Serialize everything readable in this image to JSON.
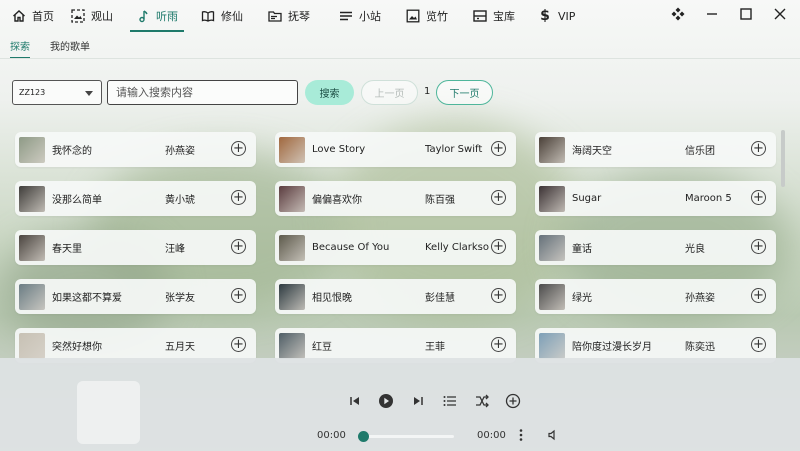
{
  "nav": {
    "items": [
      {
        "label": "首页",
        "icon": "home-icon"
      },
      {
        "label": "观山",
        "icon": "mountain-icon"
      },
      {
        "label": "听雨",
        "icon": "music-note-icon",
        "active": true
      },
      {
        "label": "修仙",
        "icon": "book-icon"
      },
      {
        "label": "抚琴",
        "icon": "folder-icon"
      },
      {
        "label": "小站",
        "icon": "menu-icon"
      },
      {
        "label": "览竹",
        "icon": "image-icon"
      },
      {
        "label": "宝库",
        "icon": "drive-icon"
      },
      {
        "label": "VIP",
        "icon": "dollar-icon"
      }
    ],
    "accent": "#1f7a6b"
  },
  "subtabs": [
    {
      "label": "探索",
      "active": true
    },
    {
      "label": "我的歌单",
      "active": false
    }
  ],
  "search": {
    "source_value": "ZZ123",
    "placeholder": "请输入搜索内容",
    "search_label": "搜索",
    "prev_label": "上一页",
    "page": "1",
    "next_label": "下一页"
  },
  "songs": [
    {
      "title": "我怀念的",
      "artist": "孙燕姿",
      "color": "#8e9a86"
    },
    {
      "title": "Love Story",
      "artist": "Taylor Swift",
      "color": "#a0683e"
    },
    {
      "title": "海阔天空",
      "artist": "信乐团",
      "color": "#4a4038"
    },
    {
      "title": "没那么简单",
      "artist": "黄小琥",
      "color": "#3f3d3a"
    },
    {
      "title": "偏偏喜欢你",
      "artist": "陈百强",
      "color": "#5b3c3f"
    },
    {
      "title": "Sugar",
      "artist": "Maroon 5",
      "color": "#3b3234"
    },
    {
      "title": "春天里",
      "artist": "汪峰",
      "color": "#4b4540"
    },
    {
      "title": "Because Of You",
      "artist": "Kelly Clarkson",
      "color": "#5d5a4c"
    },
    {
      "title": "童话",
      "artist": "光良",
      "color": "#65717a"
    },
    {
      "title": "如果这都不算爱",
      "artist": "张学友",
      "color": "#6b7d84"
    },
    {
      "title": "相见恨晚",
      "artist": "彭佳慧",
      "color": "#2e3b41"
    },
    {
      "title": "绿光",
      "artist": "孙燕姿",
      "color": "#4c4c4c"
    },
    {
      "title": "突然好想你",
      "artist": "五月天",
      "color": "#c7c1b4"
    },
    {
      "title": "红豆",
      "artist": "王菲",
      "color": "#4f5e66"
    },
    {
      "title": "陪你度过漫长岁月",
      "artist": "陈奕迅",
      "color": "#7d9fb7"
    }
  ],
  "player": {
    "current_time": "00:00",
    "total_time": "00:00",
    "progress": 0
  }
}
